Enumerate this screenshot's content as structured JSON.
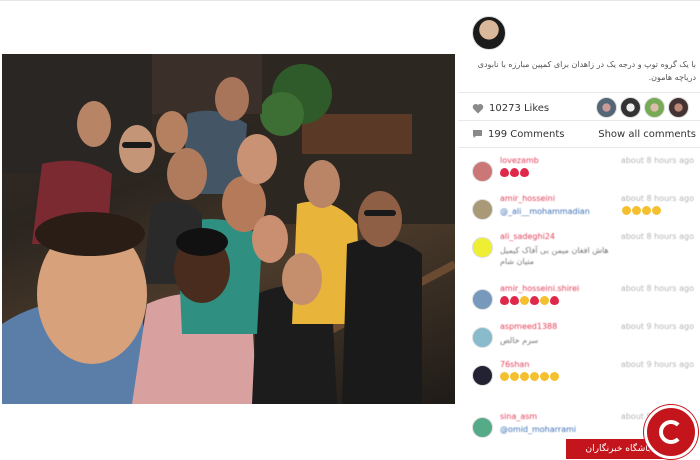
{
  "post": {
    "caption": "با یک گروه توپ و درجه یک در زاهدان برای کمپین مبارزه با نابودی دریاچه هامون.",
    "likes": "10273 Likes",
    "comments_count": "199 Comments",
    "show_all": "Show all comments"
  },
  "comments": [
    {
      "user": "lovezamb",
      "time": "about 8 hours ago",
      "text": "",
      "emoji": [
        "h",
        "h",
        "h"
      ]
    },
    {
      "user": "amir_hosseini",
      "time": "about 8 hours ago",
      "text": "@_ali__mohammadian",
      "emoji": [
        "y",
        "y",
        "y",
        "y"
      ]
    },
    {
      "user": "ali_sadeghi24",
      "time": "about 8 hours ago",
      "text": "هاش افغان میمن بی آفاک کیمیل متیان شام",
      "emoji": []
    },
    {
      "user": "amir_hosseini.shirei",
      "time": "about 8 hours ago",
      "text": "",
      "emoji": [
        "h",
        "h",
        "y",
        "h",
        "y",
        "h"
      ]
    },
    {
      "user": "aspmeed1388",
      "time": "about 9 hours ago",
      "text": "سرم خالص",
      "emoji": []
    },
    {
      "user": "76shan",
      "time": "about 9 hours ago",
      "text": "",
      "emoji": [
        "y",
        "y",
        "y",
        "y",
        "y",
        "y"
      ]
    },
    {
      "user": "sina_asm",
      "time": "about 9 hours ago",
      "text": "@omid_moharrami",
      "emoji": []
    }
  ],
  "watermark": {
    "label": "باشگاه خبرنگاران"
  },
  "colors": {
    "username": "#e2405a",
    "badge": "#c4151c"
  }
}
